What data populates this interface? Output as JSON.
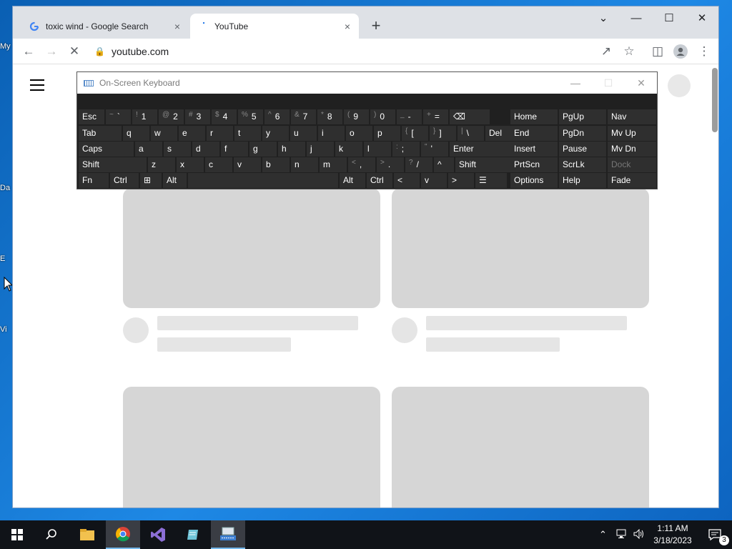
{
  "desktop": {
    "icon_labels": [
      "My",
      "Da",
      "E",
      "Vi"
    ]
  },
  "browser": {
    "tabs": [
      {
        "title": "toxic wind - Google Search",
        "favicon": "google-g-icon",
        "active": false
      },
      {
        "title": "YouTube",
        "favicon": "loading-spinner-icon",
        "active": true
      }
    ],
    "close_glyph": "×",
    "new_tab_glyph": "+",
    "url": "youtube.com",
    "window_controls": {
      "tab_search": "⌄",
      "minimize": "—",
      "maximize": "☐",
      "close": "✕"
    }
  },
  "osk": {
    "title": "On-Screen Keyboard",
    "title_controls": {
      "minimize": "—",
      "maximize": "☐",
      "close": "✕"
    },
    "rows": [
      [
        {
          "label": "Esc"
        },
        {
          "shift": "~",
          "label": "`"
        },
        {
          "shift": "!",
          "label": "1"
        },
        {
          "shift": "@",
          "label": "2"
        },
        {
          "shift": "#",
          "label": "3"
        },
        {
          "shift": "$",
          "label": "4"
        },
        {
          "shift": "%",
          "label": "5"
        },
        {
          "shift": "^",
          "label": "6"
        },
        {
          "shift": "&",
          "label": "7"
        },
        {
          "shift": "*",
          "label": "8"
        },
        {
          "shift": "(",
          "label": "9"
        },
        {
          "shift": ")",
          "label": "0"
        },
        {
          "shift": "_",
          "label": "-"
        },
        {
          "shift": "+",
          "label": "="
        },
        {
          "label": "⌫"
        }
      ],
      [
        {
          "label": "Tab"
        },
        {
          "label": "q"
        },
        {
          "label": "w"
        },
        {
          "label": "e"
        },
        {
          "label": "r"
        },
        {
          "label": "t"
        },
        {
          "label": "y"
        },
        {
          "label": "u"
        },
        {
          "label": "i"
        },
        {
          "label": "o"
        },
        {
          "label": "p"
        },
        {
          "shift": "{",
          "label": "["
        },
        {
          "shift": "}",
          "label": "]"
        },
        {
          "shift": "|",
          "label": "\\"
        },
        {
          "label": "Del"
        }
      ],
      [
        {
          "label": "Caps"
        },
        {
          "label": "a"
        },
        {
          "label": "s"
        },
        {
          "label": "d"
        },
        {
          "label": "f"
        },
        {
          "label": "g"
        },
        {
          "label": "h"
        },
        {
          "label": "j"
        },
        {
          "label": "k"
        },
        {
          "label": "l"
        },
        {
          "shift": ":",
          "label": ";"
        },
        {
          "shift": "\"",
          "label": "'"
        },
        {
          "label": "Enter"
        }
      ],
      [
        {
          "label": "Shift"
        },
        {
          "label": "z"
        },
        {
          "label": "x"
        },
        {
          "label": "c"
        },
        {
          "label": "v"
        },
        {
          "label": "b"
        },
        {
          "label": "n"
        },
        {
          "label": "m"
        },
        {
          "shift": "<",
          "label": ","
        },
        {
          "shift": ">",
          "label": "."
        },
        {
          "shift": "?",
          "label": "/"
        },
        {
          "label": "^"
        },
        {
          "label": "Shift"
        }
      ],
      [
        {
          "label": "Fn"
        },
        {
          "label": "Ctrl"
        },
        {
          "label": "⊞"
        },
        {
          "label": "Alt"
        },
        {
          "label": ""
        },
        {
          "label": "Alt"
        },
        {
          "label": "Ctrl"
        },
        {
          "label": "<"
        },
        {
          "label": "v"
        },
        {
          "label": ">"
        },
        {
          "label": "☰"
        }
      ]
    ],
    "nav_rows": [
      [
        "Home",
        "PgUp",
        "Nav"
      ],
      [
        "End",
        "PgDn",
        "Mv Up"
      ],
      [
        "Insert",
        "Pause",
        "Mv Dn"
      ],
      [
        "PrtScn",
        "ScrLk",
        "Dock"
      ],
      [
        "Options",
        "Help",
        "Fade"
      ]
    ]
  },
  "taskbar": {
    "time": "1:11 AM",
    "date": "3/18/2023",
    "notification_count": "3",
    "items": [
      "start-icon",
      "search-icon",
      "file-explorer-icon",
      "chrome-icon",
      "visual-studio-icon",
      "notepad-icon",
      "on-screen-keyboard-icon"
    ]
  }
}
